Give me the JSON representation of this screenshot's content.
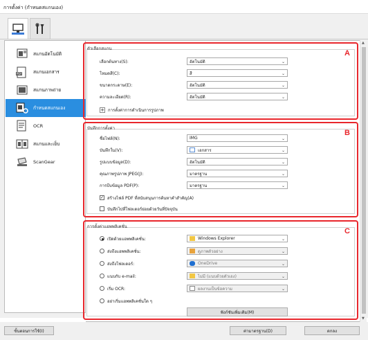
{
  "window": {
    "title": "การตั้งค่า (กำหนดสแกนเอง)"
  },
  "top_tabs": [
    {
      "name": "scan-tab",
      "icon": "computer-scan-icon"
    },
    {
      "name": "tools-tab",
      "icon": "tools-icon"
    }
  ],
  "sidebar": {
    "items": [
      {
        "label": "สแกนอัตโนมัติ",
        "icon": "auto-scan-icon"
      },
      {
        "label": "สแกนเอกสาร",
        "icon": "pdf-document-icon"
      },
      {
        "label": "สแกนภาพถ่าย",
        "icon": "photo-icon"
      },
      {
        "label": "กำหนดสแกนเอง",
        "icon": "custom-scan-icon"
      },
      {
        "label": "OCR",
        "icon": "ocr-icon"
      },
      {
        "label": "สแกนและเย็บ",
        "icon": "stitch-icon"
      },
      {
        "label": "ScanGear",
        "icon": "scangear-icon"
      }
    ],
    "active_index": 3
  },
  "section_a": {
    "title": "ตัวเลือกสแกน",
    "letter": "A",
    "rows": [
      {
        "label": "เลือกต้นทาง(S):",
        "value": "อัตโนมัติ"
      },
      {
        "label": "โหมดสี(C):",
        "value": "สี"
      },
      {
        "label": "ขนาดกระดาษ(E):",
        "value": "อัตโนมัติ"
      },
      {
        "label": "ความละเอียด(R):",
        "value": "อัตโนมัติ"
      }
    ],
    "expand_label": "การตั้งค่าการดำเนินการรูปภาพ"
  },
  "section_b": {
    "title": "บันทึกการตั้งค่า",
    "letter": "B",
    "rows": [
      {
        "label": "ชื่อไฟล์(N):",
        "value": "IMG"
      },
      {
        "label": "บันทึกใน(V):",
        "value": "เอกสาร"
      },
      {
        "label": "รูปแบบข้อมูล(D):",
        "value": "อัตโนมัติ"
      },
      {
        "label": "คุณภาพรูปภาพ JPEG(J):",
        "value": "มาตรฐาน"
      },
      {
        "label": "การบีบข้อมูล PDF(P):",
        "value": "มาตรฐาน"
      }
    ],
    "checkboxes": [
      {
        "label": "สร้างไฟล์ PDF ที่สนับสนุนการค้นหาคำสำคัญ(A)",
        "checked": true
      },
      {
        "label": "บันทึกไปที่โฟลเดอร์ย่อยด้วยวันที่ปัจจุบัน",
        "checked": false
      }
    ]
  },
  "section_c": {
    "title": "การตั้งค่าแอพพลิเคชั่น",
    "letter": "C",
    "rows": [
      {
        "label": "เปิดด้วยแอพพลิเคชั่น:",
        "value": "Windows Explorer",
        "selected": true,
        "disabled": false,
        "icon": "folder-icon"
      },
      {
        "label": "ส่งถึงแอพพลิเคชั่น:",
        "value": "ดูภาพตัวอย่าง",
        "selected": false,
        "disabled": true,
        "icon": "preview-icon"
      },
      {
        "label": "ส่งถึงโฟลเดอร์:",
        "value": "OneDrive",
        "selected": false,
        "disabled": true,
        "icon": "onedrive-icon"
      },
      {
        "label": "แนบกับ e-mail:",
        "value": "ไม่มี (แนบด้วยตัวเอง)",
        "selected": false,
        "disabled": true,
        "icon": "folder-icon"
      },
      {
        "label": "เริ่ม OCR:",
        "value": "ผลงานเป็นข้อความ",
        "selected": false,
        "disabled": true,
        "icon": "text-output-icon"
      },
      {
        "label": "อย่าเริ่มแอพพลิเคชั่นใด ๆ",
        "selected": false
      }
    ],
    "more_functions_button": "ฟังก์ชันเพิ่มเติม(M)"
  },
  "footer": {
    "instructions_button": "ขั้นตอนการใช้(I)",
    "defaults_button": "ค่ามาตรฐาน(D)",
    "ok_button": "ตกลง"
  },
  "colors": {
    "accent_red": "#e8262c",
    "selected_blue": "#2a8ee0"
  }
}
